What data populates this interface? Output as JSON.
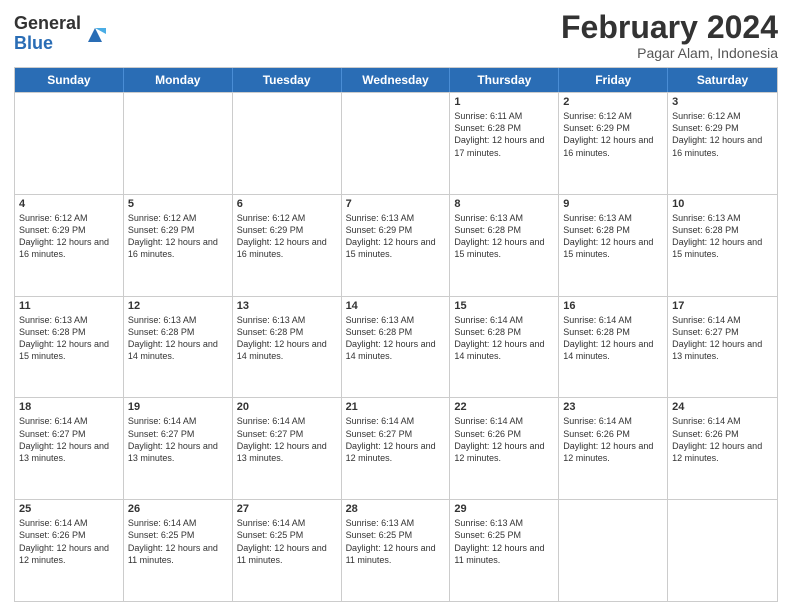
{
  "logo": {
    "general": "General",
    "blue": "Blue"
  },
  "header": {
    "month": "February 2024",
    "location": "Pagar Alam, Indonesia"
  },
  "weekdays": [
    "Sunday",
    "Monday",
    "Tuesday",
    "Wednesday",
    "Thursday",
    "Friday",
    "Saturday"
  ],
  "rows": [
    [
      {
        "day": "",
        "info": ""
      },
      {
        "day": "",
        "info": ""
      },
      {
        "day": "",
        "info": ""
      },
      {
        "day": "",
        "info": ""
      },
      {
        "day": "1",
        "info": "Sunrise: 6:11 AM\nSunset: 6:28 PM\nDaylight: 12 hours and 17 minutes."
      },
      {
        "day": "2",
        "info": "Sunrise: 6:12 AM\nSunset: 6:29 PM\nDaylight: 12 hours and 16 minutes."
      },
      {
        "day": "3",
        "info": "Sunrise: 6:12 AM\nSunset: 6:29 PM\nDaylight: 12 hours and 16 minutes."
      }
    ],
    [
      {
        "day": "4",
        "info": "Sunrise: 6:12 AM\nSunset: 6:29 PM\nDaylight: 12 hours and 16 minutes."
      },
      {
        "day": "5",
        "info": "Sunrise: 6:12 AM\nSunset: 6:29 PM\nDaylight: 12 hours and 16 minutes."
      },
      {
        "day": "6",
        "info": "Sunrise: 6:12 AM\nSunset: 6:29 PM\nDaylight: 12 hours and 16 minutes."
      },
      {
        "day": "7",
        "info": "Sunrise: 6:13 AM\nSunset: 6:29 PM\nDaylight: 12 hours and 15 minutes."
      },
      {
        "day": "8",
        "info": "Sunrise: 6:13 AM\nSunset: 6:28 PM\nDaylight: 12 hours and 15 minutes."
      },
      {
        "day": "9",
        "info": "Sunrise: 6:13 AM\nSunset: 6:28 PM\nDaylight: 12 hours and 15 minutes."
      },
      {
        "day": "10",
        "info": "Sunrise: 6:13 AM\nSunset: 6:28 PM\nDaylight: 12 hours and 15 minutes."
      }
    ],
    [
      {
        "day": "11",
        "info": "Sunrise: 6:13 AM\nSunset: 6:28 PM\nDaylight: 12 hours and 15 minutes."
      },
      {
        "day": "12",
        "info": "Sunrise: 6:13 AM\nSunset: 6:28 PM\nDaylight: 12 hours and 14 minutes."
      },
      {
        "day": "13",
        "info": "Sunrise: 6:13 AM\nSunset: 6:28 PM\nDaylight: 12 hours and 14 minutes."
      },
      {
        "day": "14",
        "info": "Sunrise: 6:13 AM\nSunset: 6:28 PM\nDaylight: 12 hours and 14 minutes."
      },
      {
        "day": "15",
        "info": "Sunrise: 6:14 AM\nSunset: 6:28 PM\nDaylight: 12 hours and 14 minutes."
      },
      {
        "day": "16",
        "info": "Sunrise: 6:14 AM\nSunset: 6:28 PM\nDaylight: 12 hours and 14 minutes."
      },
      {
        "day": "17",
        "info": "Sunrise: 6:14 AM\nSunset: 6:27 PM\nDaylight: 12 hours and 13 minutes."
      }
    ],
    [
      {
        "day": "18",
        "info": "Sunrise: 6:14 AM\nSunset: 6:27 PM\nDaylight: 12 hours and 13 minutes."
      },
      {
        "day": "19",
        "info": "Sunrise: 6:14 AM\nSunset: 6:27 PM\nDaylight: 12 hours and 13 minutes."
      },
      {
        "day": "20",
        "info": "Sunrise: 6:14 AM\nSunset: 6:27 PM\nDaylight: 12 hours and 13 minutes."
      },
      {
        "day": "21",
        "info": "Sunrise: 6:14 AM\nSunset: 6:27 PM\nDaylight: 12 hours and 12 minutes."
      },
      {
        "day": "22",
        "info": "Sunrise: 6:14 AM\nSunset: 6:26 PM\nDaylight: 12 hours and 12 minutes."
      },
      {
        "day": "23",
        "info": "Sunrise: 6:14 AM\nSunset: 6:26 PM\nDaylight: 12 hours and 12 minutes."
      },
      {
        "day": "24",
        "info": "Sunrise: 6:14 AM\nSunset: 6:26 PM\nDaylight: 12 hours and 12 minutes."
      }
    ],
    [
      {
        "day": "25",
        "info": "Sunrise: 6:14 AM\nSunset: 6:26 PM\nDaylight: 12 hours and 12 minutes."
      },
      {
        "day": "26",
        "info": "Sunrise: 6:14 AM\nSunset: 6:25 PM\nDaylight: 12 hours and 11 minutes."
      },
      {
        "day": "27",
        "info": "Sunrise: 6:14 AM\nSunset: 6:25 PM\nDaylight: 12 hours and 11 minutes."
      },
      {
        "day": "28",
        "info": "Sunrise: 6:13 AM\nSunset: 6:25 PM\nDaylight: 12 hours and 11 minutes."
      },
      {
        "day": "29",
        "info": "Sunrise: 6:13 AM\nSunset: 6:25 PM\nDaylight: 12 hours and 11 minutes."
      },
      {
        "day": "",
        "info": ""
      },
      {
        "day": "",
        "info": ""
      }
    ]
  ]
}
